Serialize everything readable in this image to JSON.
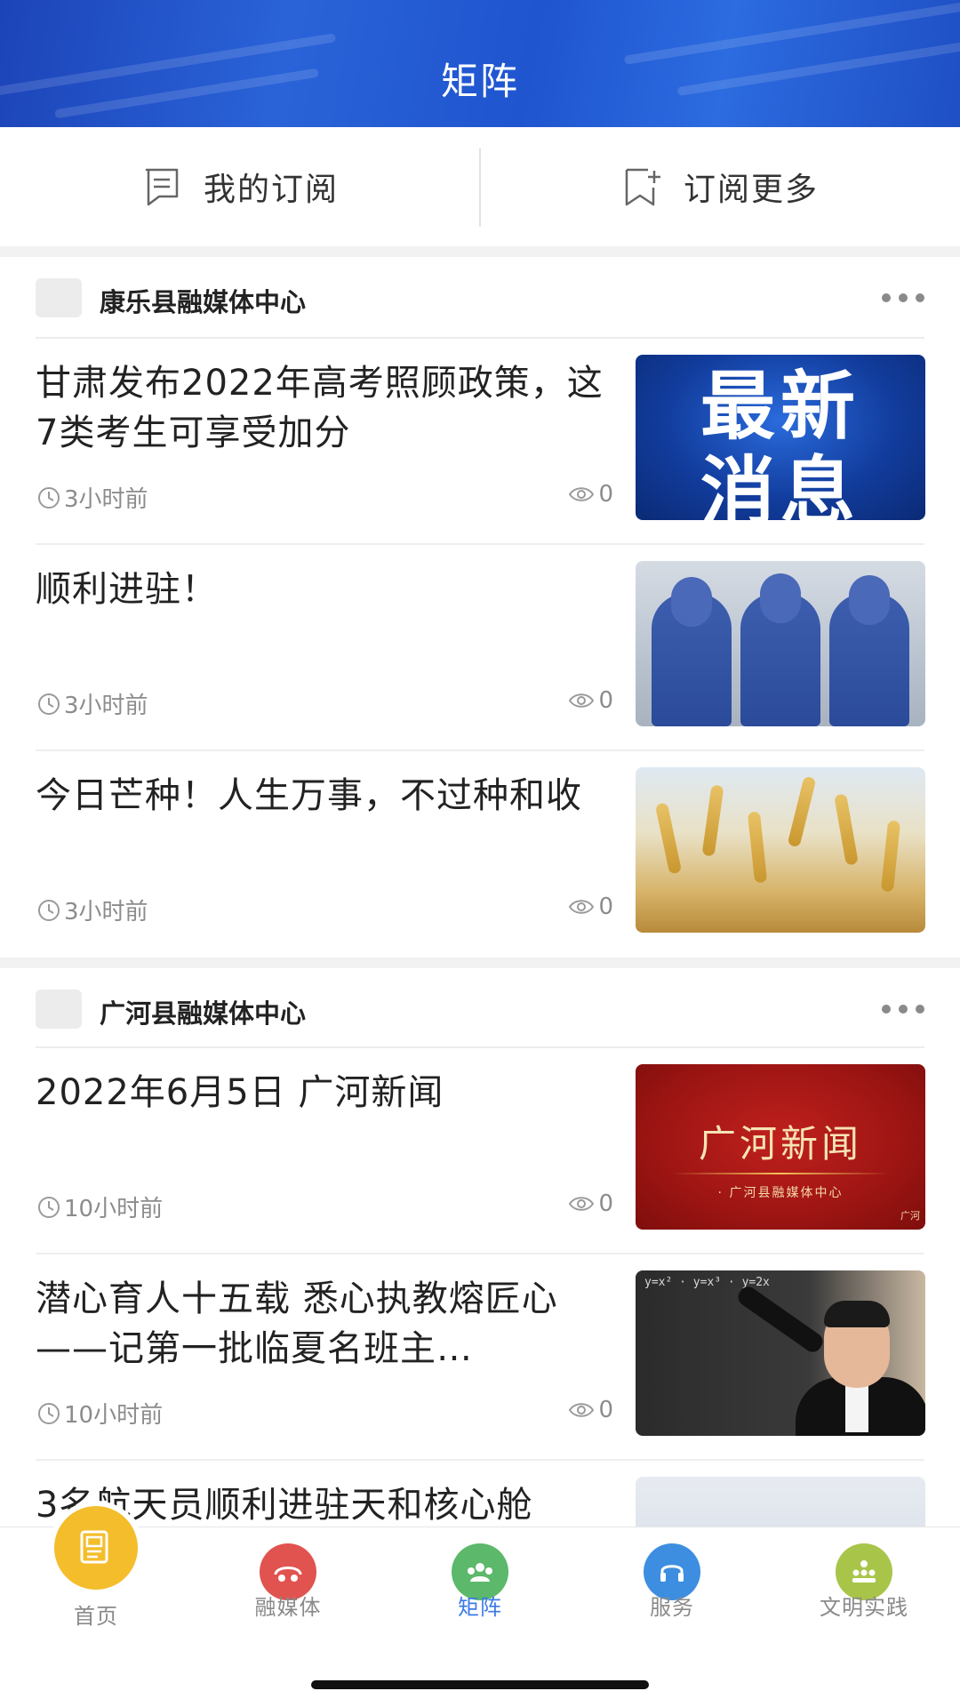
{
  "header": {
    "title": "矩阵"
  },
  "subscription": {
    "my_subscription": "我的订阅",
    "subscribe_more": "订阅更多"
  },
  "channels": [
    {
      "name": "康乐县融媒体中心",
      "articles": [
        {
          "title": "甘肃发布2022年高考照顾政策，这7类考生可享受加分",
          "time": "3小时前",
          "views": "0",
          "thumb_text": "最新消息"
        },
        {
          "title": "顺利进驻！",
          "time": "3小时前",
          "views": "0"
        },
        {
          "title": "今日芒种！人生万事，不过种和收",
          "time": "3小时前",
          "views": "0"
        }
      ]
    },
    {
      "name": "广河县融媒体中心",
      "articles": [
        {
          "title": "2022年6月5日 广河新闻",
          "time": "10小时前",
          "views": "0",
          "thumb_text": "广河新闻",
          "thumb_subtext": "· 广河县融媒体中心",
          "thumb_badge": "广河"
        },
        {
          "title": "潜心育人十五载 悉心执教熔匠心——记第一批临夏名班主…",
          "time": "10小时前",
          "views": "0"
        },
        {
          "title": "3名航天员顺利进驻天和核心舱",
          "time": "",
          "views": ""
        }
      ]
    }
  ],
  "bottom_nav": [
    {
      "label": "首页",
      "color": "#f4bd2c",
      "icon": "news-icon"
    },
    {
      "label": "融媒体",
      "color": "#e0534f",
      "icon": "media-icon"
    },
    {
      "label": "矩阵",
      "color": "#5cb86a",
      "icon": "matrix-icon",
      "active": true
    },
    {
      "label": "服务",
      "color": "#3d8ee0",
      "icon": "headset-icon"
    },
    {
      "label": "文明实践",
      "color": "#a8c54a",
      "icon": "people-icon"
    }
  ],
  "colors": {
    "brand_blue": "#1f55cf",
    "active_tab": "#3b7be6"
  }
}
